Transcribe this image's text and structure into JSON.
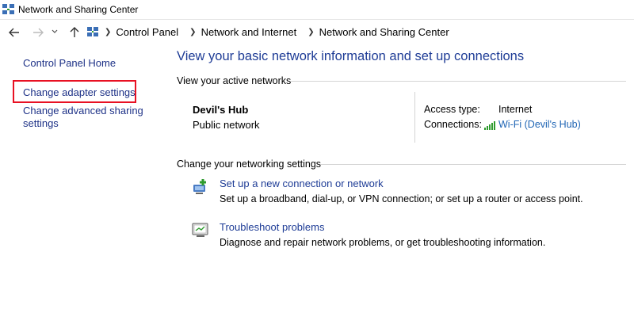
{
  "window": {
    "title": "Network and Sharing Center"
  },
  "address_bar": {
    "crumbs": [
      "Control Panel",
      "Network and Internet",
      "Network and Sharing Center"
    ]
  },
  "left_pane": {
    "home": "Control Panel Home",
    "adapter": "Change adapter settings",
    "sharing": "Change advanced sharing settings"
  },
  "main": {
    "title": "View your basic network information and set up connections",
    "active_networks_label": "View your active networks",
    "network": {
      "name": "Devil's Hub",
      "type": "Public network",
      "access_type_label": "Access type:",
      "access_type_value": "Internet",
      "connections_label": "Connections:",
      "connection_link": "Wi-Fi (Devil's Hub)"
    },
    "settings_label": "Change your networking settings",
    "tasks": [
      {
        "icon": "network-setup-icon",
        "link": "Set up a new connection or network",
        "desc": "Set up a broadband, dial-up, or VPN connection; or set up a router or access point."
      },
      {
        "icon": "troubleshoot-icon",
        "link": "Troubleshoot problems",
        "desc": "Diagnose and repair network problems, or get troubleshooting information."
      }
    ]
  },
  "colors": {
    "link": "#1e3287",
    "title": "#1e3c96",
    "highlight": "#e81123",
    "wifi": "#2e9b2e"
  }
}
